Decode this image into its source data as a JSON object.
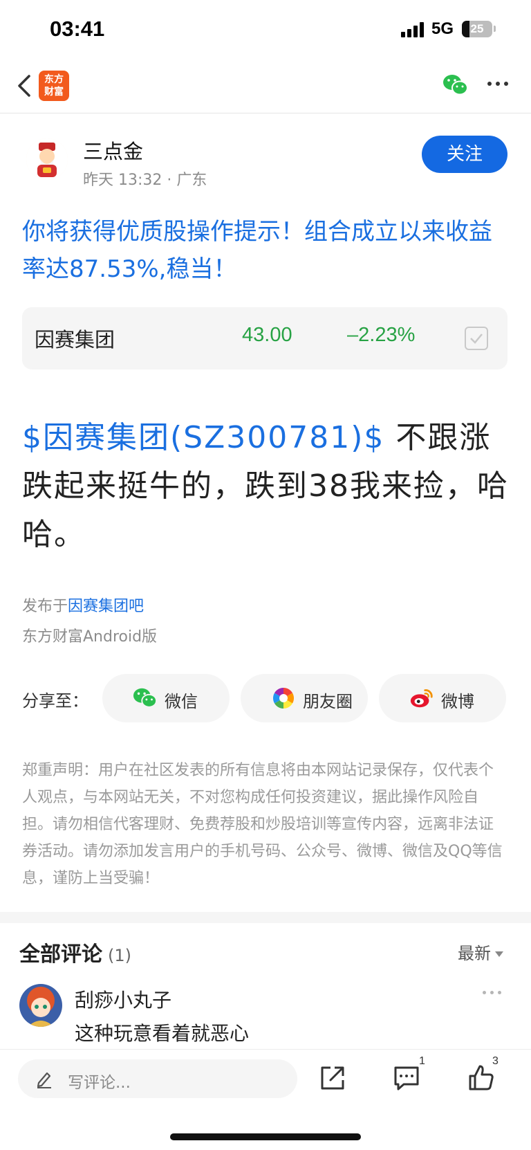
{
  "status_bar": {
    "time": "03:41",
    "network": "5G",
    "battery": "25",
    "battery_level": 0.25
  },
  "nav": {
    "logo_text": "东方\n财富"
  },
  "post": {
    "author": "三点金",
    "meta": "昨天 13:32 · 广东",
    "follow_label": "关注",
    "promo_title": "你将获得优质股操作提示！组合成立以来收益率达87.53%,稳当！",
    "stock": {
      "name": "因赛集团",
      "price": "43.00",
      "change": "–2.23%"
    },
    "body_link": "$因赛集团(SZ300781)$",
    "body_text": "  不跟涨跌起来挺牛的，跌到38我来捡，哈哈。",
    "published_prefix": "发布于",
    "published_bar": "因赛集团吧",
    "client": "东方财富Android版"
  },
  "share": {
    "label": "分享至：",
    "wechat": "微信",
    "moments": "朋友圈",
    "weibo": "微博"
  },
  "disclaimer": "郑重声明：用户在社区发表的所有信息将由本网站记录保存，仅代表个人观点，与本网站无关，不对您构成任何投资建议，据此操作风险自担。请勿相信代客理财、免费荐股和炒股培训等宣传内容，远离非法证券活动。请勿添加发言用户的手机号码、公众号、微博、微信及QQ等信息，谨防上当受骗！",
  "comments": {
    "title": "全部评论",
    "count": "(1)",
    "sort": "最新",
    "items": [
      {
        "user": "刮痧小丸子",
        "text": "这种玩意看着就恶心"
      }
    ]
  },
  "bottom_bar": {
    "placeholder": "写评论...",
    "comment_badge": "1",
    "like_badge": "3"
  },
  "colors": {
    "accent": "#1469e2",
    "down": "#27a244",
    "brand": "#f25a1d"
  }
}
